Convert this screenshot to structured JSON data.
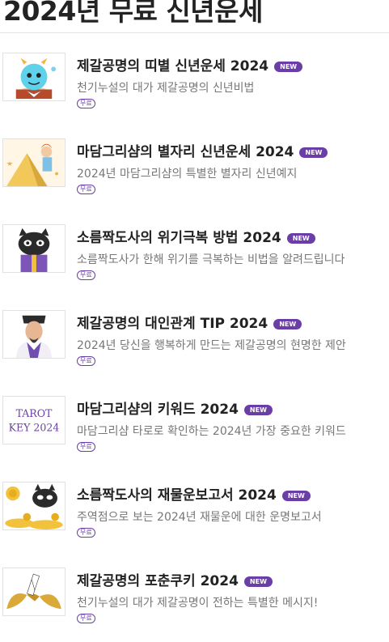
{
  "page": {
    "title": "2024년 무료 신년운세"
  },
  "badge_new": "NEW",
  "tag_free": "무료",
  "items": [
    {
      "title": "제갈공명의 띠별 신년운세 2024",
      "desc": "천기누설의 대가 제갈공명의 신년비법",
      "thumb": "dragon-character"
    },
    {
      "title": "마담그리샴의 별자리 신년운세 2024",
      "desc": "2024년 마담그리샴의 특별한 별자리 신년예지",
      "thumb": "fortune-teller-pyramid"
    },
    {
      "title": "소름짝도사의 위기극복 방법 2024",
      "desc": "소름짝도사가 한해 위기를 극복하는 비법을 알려드립니다",
      "thumb": "cat-sage"
    },
    {
      "title": "제갈공명의 대인관계 TIP 2024",
      "desc": "2024년 당신을 행복하게 만드는 제갈공명의 현명한 제안",
      "thumb": "scholar-portrait"
    },
    {
      "title": "마담그리샴의 키워드 2024",
      "desc": "마담그리샴 타로로 확인하는 2024년 가장 중요한 키워드",
      "thumb": "tarot-key",
      "thumb_text": [
        "TAROT",
        "KEY 2024"
      ]
    },
    {
      "title": "소름짝도사의 재물운보고서 2024",
      "desc": "주역점으로 보는 2024년 재물운에 대한 운명보고서",
      "thumb": "cat-coins"
    },
    {
      "title": "제갈공명의 포춘쿠키 2024",
      "desc": "천기누설의 대가 제갈공명이 전하는 특별한 메시지!",
      "thumb": "fortune-cookie"
    }
  ]
}
